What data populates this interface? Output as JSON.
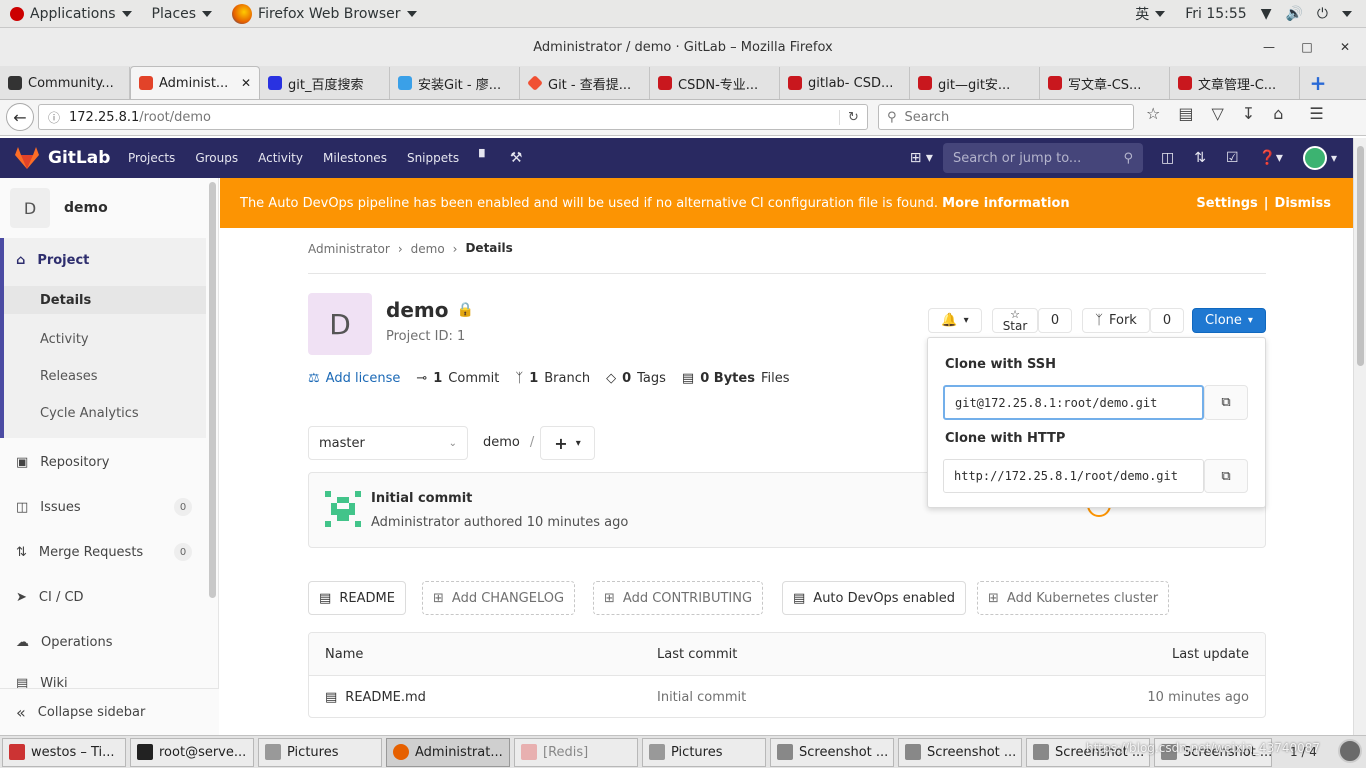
{
  "topbar": {
    "applications": "Applications",
    "places": "Places",
    "browser": "Firefox Web Browser",
    "ime": "英",
    "clock": "Fri 15:55"
  },
  "window": {
    "title": "Administrator / demo · GitLab – Mozilla Firefox"
  },
  "tabs": [
    {
      "label": "Community..."
    },
    {
      "label": "Administ..."
    },
    {
      "label": "git_百度搜索"
    },
    {
      "label": "安装Git - 廖..."
    },
    {
      "label": "Git - 查看提..."
    },
    {
      "label": "CSDN-专业..."
    },
    {
      "label": "gitlab- CSD..."
    },
    {
      "label": "git—git安..."
    },
    {
      "label": "写文章-CS..."
    },
    {
      "label": "文章管理-C..."
    }
  ],
  "nav": {
    "url_host": "172.25.8.1",
    "url_path": "/root/demo",
    "search_placeholder": "Search"
  },
  "gitlab": {
    "brand": "GitLab",
    "menu": {
      "projects": "Projects",
      "groups": "Groups",
      "activity": "Activity",
      "milestones": "Milestones",
      "snippets": "Snippets"
    },
    "search_placeholder": "Search or jump to...",
    "sidebar": {
      "project_letter": "D",
      "project_name": "demo",
      "project": "Project",
      "details": "Details",
      "activity": "Activity",
      "releases": "Releases",
      "cycle": "Cycle Analytics",
      "repository": "Repository",
      "issues": "Issues",
      "issues_count": "0",
      "merge": "Merge Requests",
      "merge_count": "0",
      "cicd": "CI / CD",
      "operations": "Operations",
      "wiki": "Wiki",
      "collapse": "Collapse sidebar"
    },
    "banner": {
      "text": "The Auto DevOps pipeline has been enabled and will be used if no alternative CI configuration file is found.",
      "link": "More information",
      "settings": "Settings",
      "sep": "|",
      "dismiss": "Dismiss"
    },
    "breadcrumb": [
      "Administrator",
      "demo",
      "Details"
    ],
    "project": {
      "avatar": "D",
      "name": "demo",
      "id": "Project ID: 1",
      "star": "Star",
      "star_count": "0",
      "fork": "Fork",
      "fork_count": "0",
      "clone": "Clone"
    },
    "stats": {
      "license": "Add license",
      "commits_n": "1",
      "commits": "Commit",
      "branches_n": "1",
      "branches": "Branch",
      "tags_n": "0",
      "tags": "Tags",
      "size_n": "0 Bytes",
      "size": "Files"
    },
    "clone_panel": {
      "ssh_title": "Clone with SSH",
      "ssh_url": "git@172.25.8.1:root/demo.git",
      "http_title": "Clone with HTTP",
      "http_url": "http://172.25.8.1/root/demo.git"
    },
    "tree": {
      "branch": "master",
      "path": "demo",
      "slash": "/"
    },
    "commit": {
      "title": "Initial commit",
      "meta": "Administrator authored 10 minutes ago"
    },
    "buttons": {
      "readme": "README",
      "changelog": "Add CHANGELOG",
      "contributing": "Add CONTRIBUTING",
      "autodevops": "Auto DevOps enabled",
      "k8s": "Add Kubernetes cluster"
    },
    "table": {
      "headers": [
        "Name",
        "Last commit",
        "Last update"
      ],
      "rows": [
        {
          "name": "README.md",
          "commit": "Initial commit",
          "updated": "10 minutes ago"
        }
      ]
    }
  },
  "taskbar": [
    {
      "label": "westos – Ti..."
    },
    {
      "label": "root@serve..."
    },
    {
      "label": "Pictures"
    },
    {
      "label": "Administrat..."
    },
    {
      "label": "[Redis]"
    },
    {
      "label": "Pictures"
    },
    {
      "label": "Screenshot ..."
    },
    {
      "label": "Screenshot ..."
    },
    {
      "label": "Screenshot ..."
    },
    {
      "label": "Screenshot ..."
    }
  ],
  "taskbar_pager": "1 / 4",
  "watermark": "https://blog.csdn.net/weixin_43740087",
  "colors": {
    "gitlab_header": "#292961",
    "banner": "#fc9403",
    "clone_btn": "#1f78d1"
  }
}
